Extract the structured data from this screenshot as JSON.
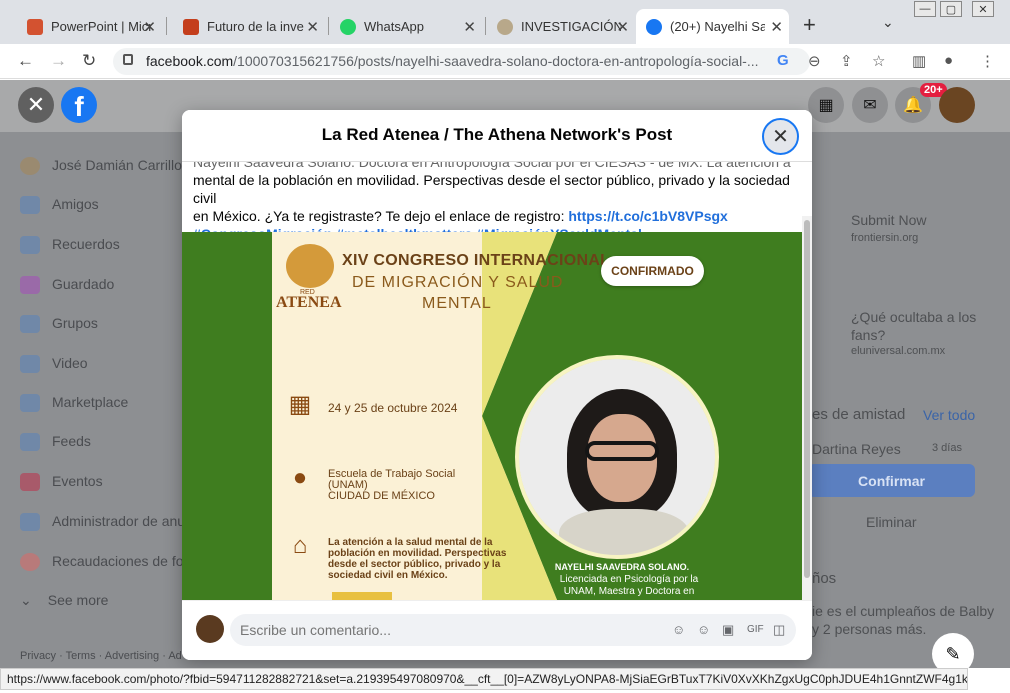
{
  "browser": {
    "tabs": [
      {
        "label": "PowerPoint | Micr",
        "color": "#d35230"
      },
      {
        "label": "Futuro de la inve",
        "color": "#c43e1c"
      },
      {
        "label": "WhatsApp",
        "color": "#25d366"
      },
      {
        "label": "INVESTIGACIÓN",
        "color": "#b8a88a"
      },
      {
        "label": "(20+) Nayelhi Saa",
        "color": "#1877f2"
      }
    ],
    "close_glyph": "✕",
    "new_tab": "+",
    "url_host": "facebook.com",
    "url_path": "/100070315621756/posts/nayelhi-saavedra-solano-doctora-en-antropología-social-..."
  },
  "fb": {
    "logo": "f",
    "close": "✕",
    "notif_badge": "20+",
    "sidebar": [
      {
        "label": "José Damián Carrillo"
      },
      {
        "label": "Amigos"
      },
      {
        "label": "Recuerdos"
      },
      {
        "label": "Guardado"
      },
      {
        "label": "Grupos"
      },
      {
        "label": "Video"
      },
      {
        "label": "Marketplace"
      },
      {
        "label": "Feeds"
      },
      {
        "label": "Eventos"
      },
      {
        "label": "Administrador de anu"
      },
      {
        "label": "Recaudaciones de fon"
      },
      {
        "label": "See more"
      }
    ],
    "footer_links": "Privacy · Terms · Advertising · Ad",
    "right": {
      "ad1_title": "Submit Now",
      "ad1_src": "frontiersin.org",
      "ad2_title": "¿Qué ocultaba a los fans?",
      "ad2_src": "eluniversal.com.mx",
      "requests_heading": "es de amistad",
      "see_all": "Ver todo",
      "request_name": "Dartina Reyes",
      "request_time": "3 días",
      "confirm": "Confirmar",
      "delete": "Eliminar",
      "birthdays": "ños",
      "birthday_text": "ie es el cumpleaños de Balby",
      "birthday_text2": "y 2 personas más."
    }
  },
  "modal": {
    "title": "La Red Atenea / The Athena Network's Post",
    "close": "✕",
    "text_cut": "Nayelhi Saavedra Solano. Doctora en Antropología Social por el CIESAS - de MX. La atención a la salud",
    "text_line2": "mental de la población en movilidad. Perspectivas desde el sector público, privado y la sociedad civil",
    "text_line3": "en México. ¿Ya te registraste? Te dejo el enlace de registro:",
    "link": "https://t.co/c1bV8VPsgx",
    "tags": "#CongresoMigración #metalhealthmatters #MigraciónYSauldMental",
    "poster": {
      "title1": "XIV CONGRESO INTERNACIONAL",
      "title2": "DE MIGRACIÓN Y SALUD",
      "title3": "MENTAL",
      "confirmado": "CONFIRMADO",
      "atenea": "ATENEA",
      "red": "RED",
      "date": "24 y 25 de octubre 2024",
      "place1": "Escuela de Trabajo Social",
      "place2": "(UNAM)",
      "place3": "CIUDAD DE MÉXICO",
      "topic": "La atención a la salud mental de la población en movilidad. Perspectivas desde el sector público, privado y la sociedad civil en México.",
      "name": "NAYELHI SAAVEDRA SOLANO.",
      "desc": "Licenciada en Psicología por la UNAM, Maestra y Doctora en"
    },
    "comment_placeholder": "Escribe un comentario..."
  },
  "status_url": "https://www.facebook.com/photo/?fbid=594711282882721&set=a.219395497080970&__cft__[0]=AZW8yLyONPA8-MjSiaEGrBTuxT7KiV0XvXKhZgxUgC0phJDUE4h1GnntZWF4g1kP..."
}
